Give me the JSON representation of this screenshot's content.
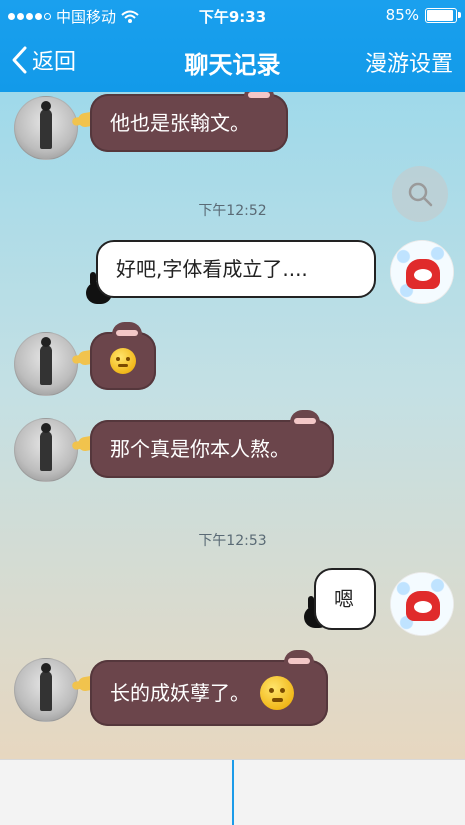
{
  "status_bar": {
    "carrier": "中国移动",
    "time": "下午9:33",
    "battery": "85%",
    "battery_level": 0.85
  },
  "nav": {
    "back_label": "返回",
    "title": "聊天记录",
    "roaming_label": "漫游设置"
  },
  "messages": [
    {
      "from": "friend",
      "text": "他也是张翰文。"
    },
    {
      "timestamp": "下午12:52"
    },
    {
      "from": "me",
      "text": "好吧,字体看成立了...."
    },
    {
      "from": "friend",
      "text": "",
      "emoji": "sad-face"
    },
    {
      "from": "friend",
      "text": "那个真是你本人熬。"
    },
    {
      "timestamp": "下午12:53"
    },
    {
      "from": "me",
      "text": "嗯"
    },
    {
      "from": "friend",
      "text": "长的成妖孽了。",
      "emoji": "smirk-face"
    }
  ],
  "colors": {
    "nav_blue": "#1aa0ee",
    "friend_bubble": "#6b454b",
    "me_bubble": "#ffffff"
  }
}
